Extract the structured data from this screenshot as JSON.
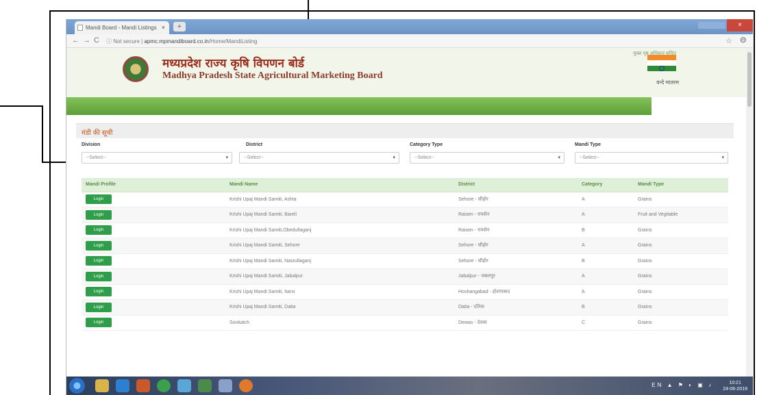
{
  "browser": {
    "tab_title": "Mandi Board - Mandi Listings",
    "tab_close": "×",
    "new_tab": "+",
    "win_close": "×",
    "back": "←",
    "forward": "→",
    "reload": "C",
    "security": "ⓘ Not secure",
    "url_host": "apmc.mpmandiboard.co.in",
    "url_path": "/Home/MandiListing",
    "star": "☆",
    "account": "Θ"
  },
  "header": {
    "top_links": "मुख्य पृष्ठ  अधिकार सूचित",
    "title_hi": "मध्यप्रदेश राज्य कृषि विपणन बोर्ड",
    "title_en": "Madhya Pradesh State Agricultural Marketing Board",
    "motto": "वन्दे मातरम",
    "colors": {
      "saffron": "#f28c28",
      "green": "#2f8a3a",
      "band": "#6fae47"
    }
  },
  "panel": {
    "title": "मंडी की सूची",
    "filters": [
      {
        "label": "Division",
        "value": "--Select--"
      },
      {
        "label": "District",
        "value": "--Select--"
      },
      {
        "label": "Category Type",
        "value": "--Select--"
      },
      {
        "label": "Mandi Type",
        "value": "--Select--"
      }
    ],
    "caret": "▾",
    "columns": [
      "Mandi Profile",
      "Mandi Name",
      "District",
      "Category",
      "Mandi Type"
    ],
    "login_label": "Login",
    "rows": [
      {
        "name": "Krishi Upaj Mandi Samiti, Ashta",
        "district": "Sehore - सीहोर",
        "category": "A",
        "type": "Grains"
      },
      {
        "name": "Krishi Upaj Mandi Samiti, Bareli",
        "district": "Raisen - रायसेन",
        "category": "A",
        "type": "Fruit and Vegitable"
      },
      {
        "name": "Krishi Upaj Mandi Samiti,Obedullaganj",
        "district": "Raisen - रायसेन",
        "category": "B",
        "type": "Grains"
      },
      {
        "name": "Krishi Upaj Mandi Samiti, Sehore",
        "district": "Sehore - सीहोर",
        "category": "A",
        "type": "Grains"
      },
      {
        "name": "Krishi Upaj Mandi Samiti, Nasrullaganj",
        "district": "Sehore - सीहोर",
        "category": "B",
        "type": "Grains"
      },
      {
        "name": "Krishi Upaj Mandi Samiti, Jabalpur",
        "district": "Jabalpur - जबलपुर",
        "category": "A",
        "type": "Grains"
      },
      {
        "name": "Krishi Upaj Mandi Samiti, Itarsi",
        "district": "Hoshangabad - होशंगाबाद",
        "category": "A",
        "type": "Grains"
      },
      {
        "name": "Krishi Upaj Mandi Samiti, Datia",
        "district": "Datia - दतिया",
        "category": "B",
        "type": "Grains"
      },
      {
        "name": "Sonkatch",
        "district": "Dewas - देवास",
        "category": "C",
        "type": "Grains"
      }
    ]
  },
  "taskbar": {
    "tray": "EN ▲ ⚑ ◐ ▣ ♪",
    "time": "10:21",
    "date": "24-06-2019"
  }
}
